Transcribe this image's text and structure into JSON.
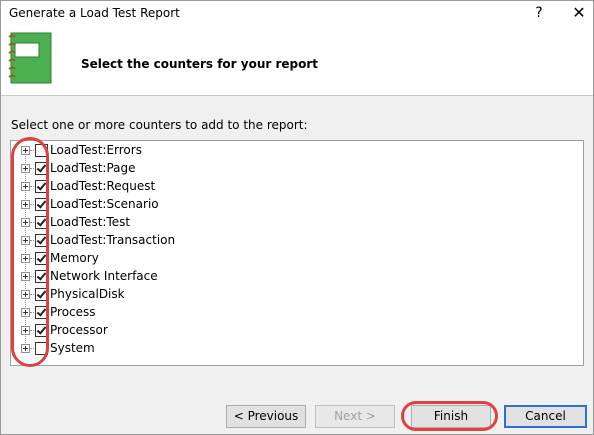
{
  "window": {
    "title": "Generate a Load Test Report",
    "help_glyph": "?",
    "close_glyph": "✕"
  },
  "header": {
    "heading": "Select the counters for your report",
    "icon": "notebook-icon"
  },
  "instruction": "Select one or more counters to add to the report:",
  "counters": [
    {
      "label": "LoadTest:Errors",
      "checked": false
    },
    {
      "label": "LoadTest:Page",
      "checked": true
    },
    {
      "label": "LoadTest:Request",
      "checked": true
    },
    {
      "label": "LoadTest:Scenario",
      "checked": true
    },
    {
      "label": "LoadTest:Test",
      "checked": true
    },
    {
      "label": "LoadTest:Transaction",
      "checked": true
    },
    {
      "label": "Memory",
      "checked": true
    },
    {
      "label": "Network Interface",
      "checked": true
    },
    {
      "label": "PhysicalDisk",
      "checked": true
    },
    {
      "label": "Process",
      "checked": true
    },
    {
      "label": "Processor",
      "checked": true
    },
    {
      "label": "System",
      "checked": false
    }
  ],
  "buttons": {
    "previous": "< Previous",
    "next": "Next >",
    "finish": "Finish",
    "cancel": "Cancel"
  },
  "colors": {
    "highlight_oval": "#e04040",
    "primary_button_border": "#2e6fd3",
    "notebook_green": "#4caf50"
  }
}
